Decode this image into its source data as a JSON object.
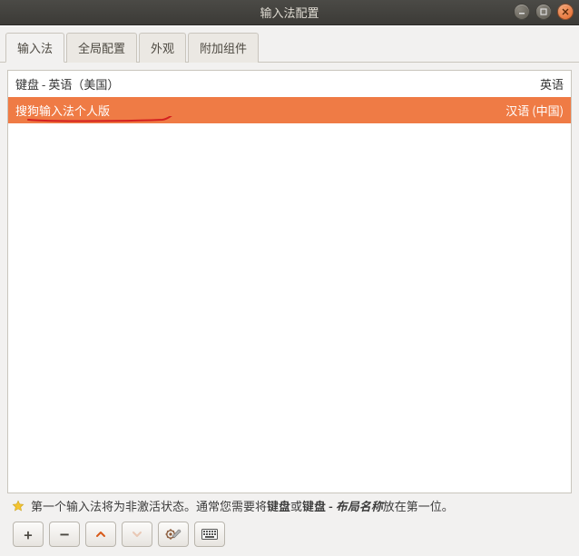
{
  "window": {
    "title": "输入法配置"
  },
  "tabs": [
    {
      "label": "输入法",
      "active": true
    },
    {
      "label": "全局配置",
      "active": false
    },
    {
      "label": "外观",
      "active": false
    },
    {
      "label": "附加组件",
      "active": false
    }
  ],
  "input_methods": [
    {
      "name": "键盘 - 英语（美国）",
      "lang": "英语",
      "selected": false
    },
    {
      "name": "搜狗输入法个人版",
      "lang": "汉语 (中国)",
      "selected": true
    }
  ],
  "hint": {
    "pre": "第一个输入法将为非激活状态。通常您需要将",
    "bold1": "键盘",
    "mid": "或",
    "bold2": "键盘 - ",
    "bolditalic": "布局名称",
    "post": "放在第一位。"
  },
  "toolbar": {
    "add": "+",
    "remove": "−",
    "up": "up",
    "down": "down",
    "config": "config",
    "keyboard": "keyboard"
  },
  "colors": {
    "selection": "#ef7b45"
  }
}
